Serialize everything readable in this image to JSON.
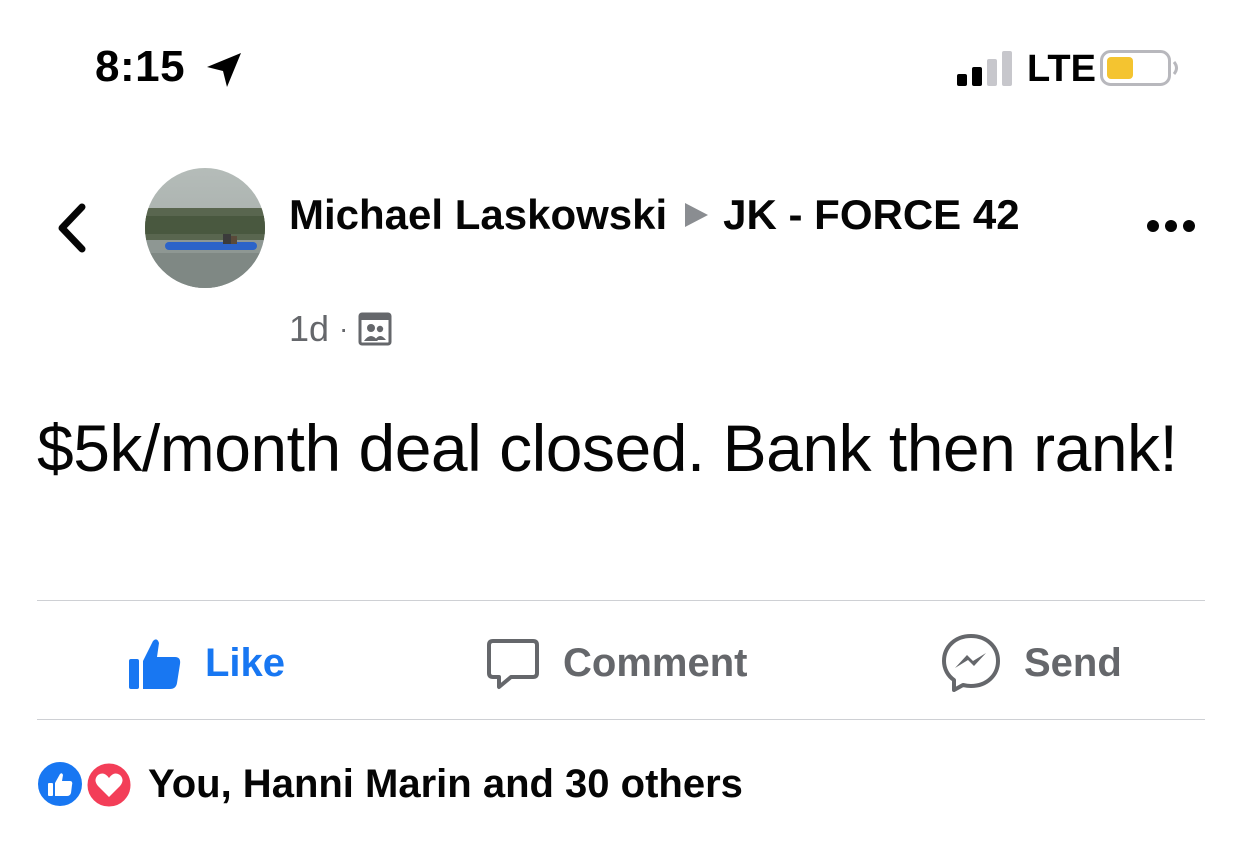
{
  "status_bar": {
    "time": "8:15",
    "network": "LTE",
    "battery_color": "#f4c430"
  },
  "post": {
    "author": "Michael Laskowski",
    "group": "JK - FORCE 42",
    "age": "1d",
    "privacy_icon": "group-icon",
    "text": "$5k/month deal closed.  Bank then rank!"
  },
  "actions": {
    "like": "Like",
    "comment": "Comment",
    "send": "Send"
  },
  "reactions": {
    "summary": "You, Hanni Marin and 30 others"
  },
  "colors": {
    "accent": "#1877f2",
    "secondary_text": "#65676b",
    "love": "#f33e58"
  }
}
